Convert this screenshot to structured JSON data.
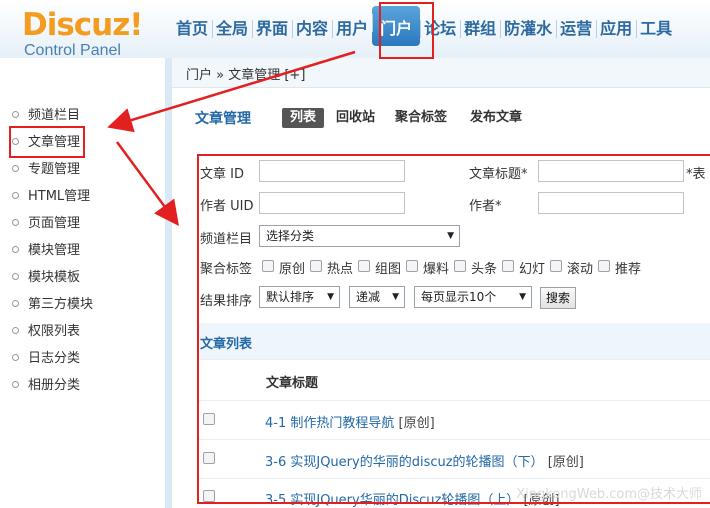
{
  "logo": {
    "main": "Discuz!",
    "sub": "Control Panel"
  },
  "topnav": [
    "首页",
    "全局",
    "界面",
    "内容",
    "用户",
    "门户",
    "论坛",
    "群组",
    "防灌水",
    "运营",
    "应用",
    "工具"
  ],
  "topnav_active": "门户",
  "breadcrumb": "门户 » 文章管理  [+]",
  "sidebar": [
    "频道栏目",
    "文章管理",
    "专题管理",
    "HTML管理",
    "页面管理",
    "模块管理",
    "模块模板",
    "第三方模块",
    "权限列表",
    "日志分类",
    "相册分类"
  ],
  "sidebar_active": "文章管理",
  "page_title": "文章管理",
  "subtabs": [
    "列表",
    "回收站",
    "聚合标签",
    "发布文章"
  ],
  "form": {
    "article_id": "文章 ID",
    "article_title": "文章标题*",
    "title_hint": "*表",
    "author_uid": "作者 UID",
    "author": "作者*",
    "channel": "频道栏目",
    "channel_select": "选择分类",
    "tags_label": "聚合标签",
    "tags": [
      "原创",
      "热点",
      "组图",
      "爆料",
      "头条",
      "幻灯",
      "滚动",
      "推荐"
    ],
    "sort_label": "结果排序",
    "sort_select": "默认排序",
    "order_select": "递减",
    "perpage_select": "每页显示10个",
    "search_button": "搜索"
  },
  "list": {
    "title": "文章列表",
    "column": "文章标题",
    "rows": [
      {
        "title": "4-1 制作热门教程导航",
        "tag": "[原创]"
      },
      {
        "title": "3-6 实现JQuery的华丽的discuz的轮播图（下）",
        "tag": "[原创]"
      },
      {
        "title": "3-5 实现JQuery华丽的Discuz轮播图（上）",
        "tag": "[原创]"
      }
    ]
  },
  "watermark": "XingkongWeb.com@技术大师",
  "colors": {
    "accent": "#2368a8",
    "logo": "#f39c20",
    "annotation": "#e32020",
    "active_tab": "#2a78bd"
  }
}
